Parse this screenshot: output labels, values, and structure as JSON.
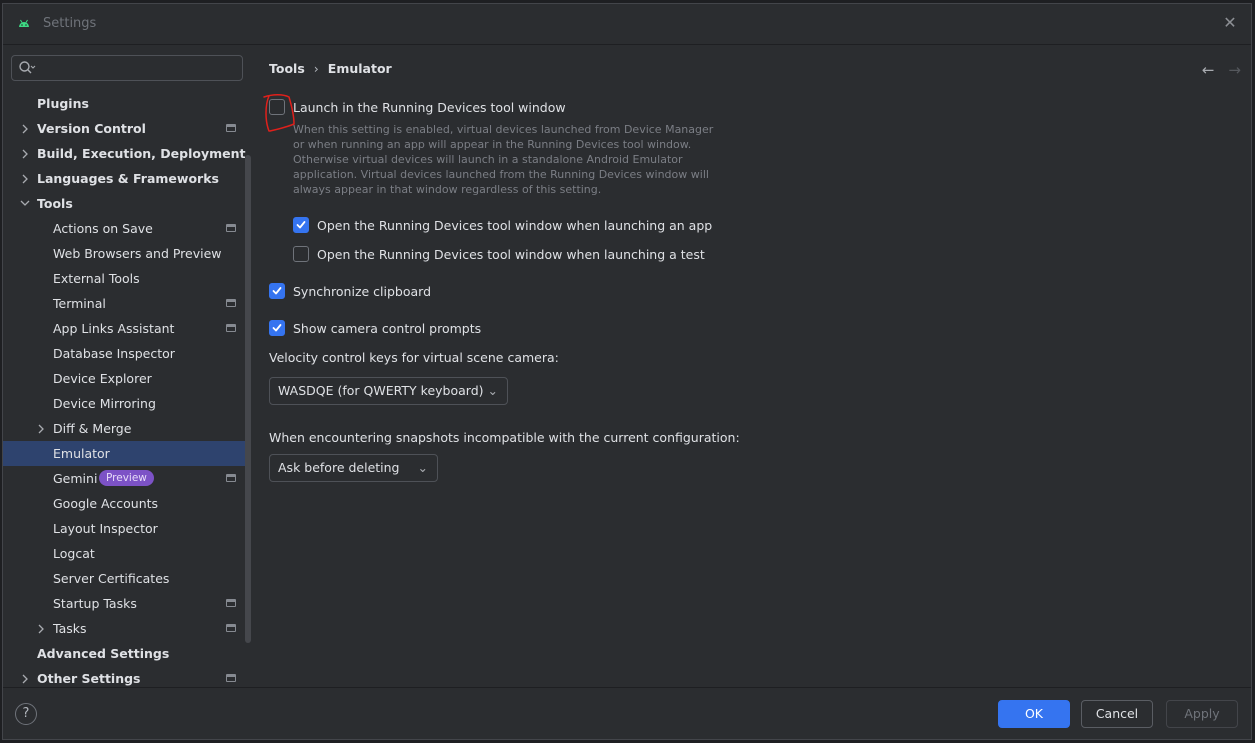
{
  "window": {
    "title": "Settings"
  },
  "search": {
    "placeholder": ""
  },
  "sidebar": {
    "items": [
      {
        "label": "Plugins",
        "level": 0,
        "bold": true,
        "expandable": false,
        "expanded": false,
        "project_icon": false,
        "selected": false
      },
      {
        "label": "Version Control",
        "level": 0,
        "bold": true,
        "expandable": true,
        "expanded": false,
        "project_icon": true,
        "selected": false
      },
      {
        "label": "Build, Execution, Deployment",
        "level": 0,
        "bold": true,
        "expandable": true,
        "expanded": false,
        "project_icon": false,
        "selected": false
      },
      {
        "label": "Languages & Frameworks",
        "level": 0,
        "bold": true,
        "expandable": true,
        "expanded": false,
        "project_icon": false,
        "selected": false
      },
      {
        "label": "Tools",
        "level": 0,
        "bold": true,
        "expandable": true,
        "expanded": true,
        "project_icon": false,
        "selected": false
      },
      {
        "label": "Actions on Save",
        "level": 1,
        "bold": false,
        "expandable": false,
        "expanded": false,
        "project_icon": true,
        "selected": false
      },
      {
        "label": "Web Browsers and Preview",
        "level": 1,
        "bold": false,
        "expandable": false,
        "expanded": false,
        "project_icon": false,
        "selected": false
      },
      {
        "label": "External Tools",
        "level": 1,
        "bold": false,
        "expandable": false,
        "expanded": false,
        "project_icon": false,
        "selected": false
      },
      {
        "label": "Terminal",
        "level": 1,
        "bold": false,
        "expandable": false,
        "expanded": false,
        "project_icon": true,
        "selected": false
      },
      {
        "label": "App Links Assistant",
        "level": 1,
        "bold": false,
        "expandable": false,
        "expanded": false,
        "project_icon": true,
        "selected": false
      },
      {
        "label": "Database Inspector",
        "level": 1,
        "bold": false,
        "expandable": false,
        "expanded": false,
        "project_icon": false,
        "selected": false
      },
      {
        "label": "Device Explorer",
        "level": 1,
        "bold": false,
        "expandable": false,
        "expanded": false,
        "project_icon": false,
        "selected": false
      },
      {
        "label": "Device Mirroring",
        "level": 1,
        "bold": false,
        "expandable": false,
        "expanded": false,
        "project_icon": false,
        "selected": false
      },
      {
        "label": "Diff & Merge",
        "level": 1,
        "bold": false,
        "expandable": true,
        "expanded": false,
        "project_icon": false,
        "selected": false
      },
      {
        "label": "Emulator",
        "level": 1,
        "bold": false,
        "expandable": false,
        "expanded": false,
        "project_icon": false,
        "selected": true
      },
      {
        "label": "Gemini",
        "level": 1,
        "bold": false,
        "expandable": false,
        "expanded": false,
        "project_icon": true,
        "selected": false,
        "badge": "Preview"
      },
      {
        "label": "Google Accounts",
        "level": 1,
        "bold": false,
        "expandable": false,
        "expanded": false,
        "project_icon": false,
        "selected": false
      },
      {
        "label": "Layout Inspector",
        "level": 1,
        "bold": false,
        "expandable": false,
        "expanded": false,
        "project_icon": false,
        "selected": false
      },
      {
        "label": "Logcat",
        "level": 1,
        "bold": false,
        "expandable": false,
        "expanded": false,
        "project_icon": false,
        "selected": false
      },
      {
        "label": "Server Certificates",
        "level": 1,
        "bold": false,
        "expandable": false,
        "expanded": false,
        "project_icon": false,
        "selected": false
      },
      {
        "label": "Startup Tasks",
        "level": 1,
        "bold": false,
        "expandable": false,
        "expanded": false,
        "project_icon": true,
        "selected": false
      },
      {
        "label": "Tasks",
        "level": 1,
        "bold": false,
        "expandable": true,
        "expanded": false,
        "project_icon": true,
        "selected": false
      },
      {
        "label": "Advanced Settings",
        "level": 0,
        "bold": true,
        "expandable": false,
        "expanded": false,
        "project_icon": false,
        "selected": false
      },
      {
        "label": "Other Settings",
        "level": 0,
        "bold": true,
        "expandable": true,
        "expanded": false,
        "project_icon": true,
        "selected": false
      }
    ]
  },
  "breadcrumb": {
    "parent": "Tools",
    "current": "Emulator"
  },
  "content": {
    "launch_in_running_devices": {
      "label": "Launch in the Running Devices tool window",
      "checked": false,
      "description": "When this setting is enabled, virtual devices launched from Device Manager or when running an app will appear in the Running Devices tool window. Otherwise virtual devices will launch in a standalone Android Emulator application. Virtual devices launched from the Running Devices window will always appear in that window regardless of this setting."
    },
    "open_when_launching_app": {
      "label": "Open the Running Devices tool window when launching an app",
      "checked": true
    },
    "open_when_launching_test": {
      "label": "Open the Running Devices tool window when launching a test",
      "checked": false
    },
    "synchronize_clipboard": {
      "label": "Synchronize clipboard",
      "checked": true
    },
    "show_camera_prompts": {
      "label": "Show camera control prompts",
      "checked": true
    },
    "velocity_keys": {
      "label": "Velocity control keys for virtual scene camera:",
      "value": "WASDQE (for QWERTY keyboard)"
    },
    "snapshots": {
      "label": "When encountering snapshots incompatible with the current configuration:",
      "value": "Ask before deleting"
    }
  },
  "footer": {
    "help": "?",
    "ok": "OK",
    "cancel": "Cancel",
    "apply": "Apply"
  },
  "colors": {
    "accent": "#3574f0",
    "selection": "#2e436e",
    "badge": "#7c52c6",
    "annotation": "#e0201b"
  },
  "icons": {
    "app": "android-icon",
    "close": "close-icon",
    "search": "search-icon",
    "back": "back-arrow-icon",
    "forward": "forward-arrow-icon"
  }
}
